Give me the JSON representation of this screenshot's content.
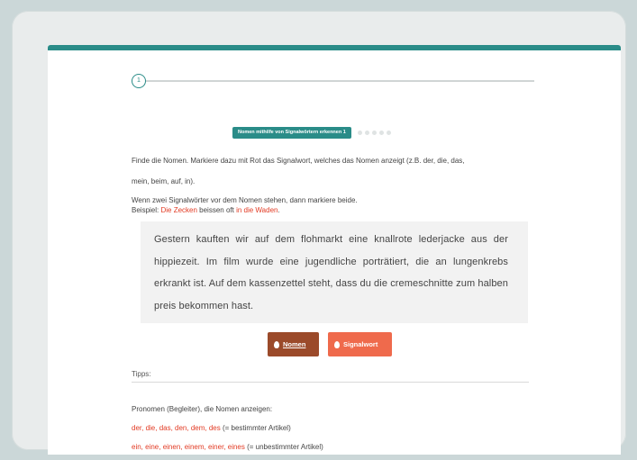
{
  "progress": {
    "step_number": "1"
  },
  "badge": {
    "label": "Nomen mithilfe von Signalwörtern erkennen 1",
    "dot_count": 5
  },
  "instructions": {
    "line1": "Finde die Nomen. Markiere dazu mit Rot das Signalwort, welches das Nomen anzeigt (z.B. der, die, das,",
    "line2": "mein, beim, auf, in).",
    "line3": "Wenn zwei Signalwörter vor dem Nomen stehen, dann markiere beide.",
    "example_prefix": "Beispiel: ",
    "example_word1": "Die Zecken",
    "example_mid": " beissen oft ",
    "example_word2": "in die Waden",
    "example_end": "."
  },
  "exercise": {
    "text": "Gestern kauften wir auf dem flohmarkt eine knallrote lederjacke aus der hippiezeit. Im film wurde eine jugendliche porträtiert, die an lungenkrebs erkrankt ist. Auf dem kassenzettel steht, dass du die cremeschnitte zum halben preis bekommen hast."
  },
  "buttons": {
    "nomen_label": "Nomen",
    "signalwort_label": "Signalwort"
  },
  "tips": {
    "heading": "Tipps:",
    "pronomen_line": "Pronomen (Begleiter), die Nomen anzeigen:",
    "definite_words": "der, die, das, den, dem, des",
    "definite_note": " (= bestimmter Artikel)",
    "indefinite_words": "ein, eine, einen, einem, einer, eines",
    "indefinite_note": " (= unbestimmter Artikel)"
  },
  "colors": {
    "teal": "#2a8c88",
    "red": "#e23b24",
    "nomen_button": "#9b4a2a",
    "signalwort_button": "#ef6a4c"
  }
}
